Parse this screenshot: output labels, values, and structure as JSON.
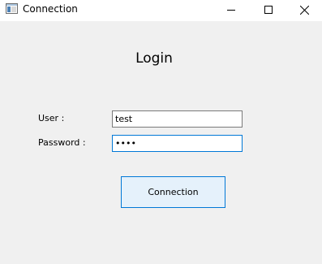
{
  "window": {
    "title": "Connection",
    "icon": "app-window-icon",
    "controls": [
      "minimize-icon",
      "maximize-icon",
      "close-icon"
    ]
  },
  "form": {
    "heading": "Login",
    "user_label": "User :",
    "user_value": "test",
    "password_label": "Password :",
    "password_value": "test",
    "submit_label": "Connection"
  },
  "colors": {
    "focus_border": "#0078d7",
    "button_bg": "#e5f1fb",
    "window_bg": "#f0f0f0"
  }
}
